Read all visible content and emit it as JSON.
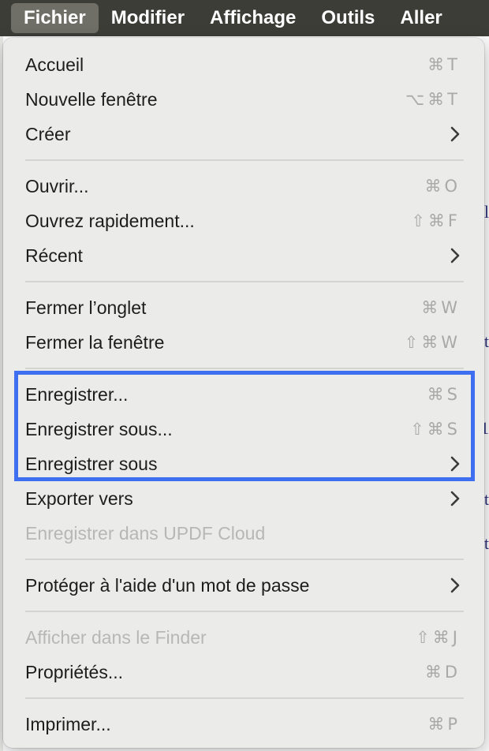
{
  "menubar": {
    "items": [
      {
        "label": "Fichier",
        "active": true
      },
      {
        "label": "Modifier"
      },
      {
        "label": "Affichage"
      },
      {
        "label": "Outils"
      },
      {
        "label": "Aller"
      }
    ]
  },
  "menu": {
    "groups": [
      [
        {
          "label": "Accueil",
          "shortcut": "⌘T"
        },
        {
          "label": "Nouvelle fenêtre",
          "shortcut": "⌥⌘T"
        },
        {
          "label": "Créer",
          "submenu": true
        }
      ],
      [
        {
          "label": "Ouvrir...",
          "shortcut": "⌘O"
        },
        {
          "label": "Ouvrez rapidement...",
          "shortcut": "⇧⌘F"
        },
        {
          "label": "Récent",
          "submenu": true
        }
      ],
      [
        {
          "label": "Fermer l’onglet",
          "shortcut": "⌘W"
        },
        {
          "label": "Fermer la fenêtre",
          "shortcut": "⇧⌘W"
        }
      ],
      [
        {
          "label": "Enregistrer...",
          "shortcut": "⌘S"
        },
        {
          "label": "Enregistrer sous...",
          "shortcut": "⇧⌘S"
        },
        {
          "label": "Enregistrer sous",
          "submenu": true
        },
        {
          "label": "Exporter vers",
          "submenu": true
        },
        {
          "label": "Enregistrer dans UPDF Cloud",
          "disabled": true
        }
      ],
      [
        {
          "label": "Protéger à l'aide d'un mot de passe",
          "submenu": true
        }
      ],
      [
        {
          "label": "Afficher dans le Finder",
          "shortcut": "⇧⌘J",
          "disabled": true
        },
        {
          "label": "Propriétés...",
          "shortcut": "⌘D"
        }
      ],
      [
        {
          "label": "Imprimer...",
          "shortcut": "⌘P"
        }
      ]
    ]
  },
  "colors": {
    "menubar_bg": "#3d3d38",
    "menu_bg": "#ebebea",
    "highlight_border": "#3e6ff0",
    "disabled_text": "#b7b7b5"
  }
}
